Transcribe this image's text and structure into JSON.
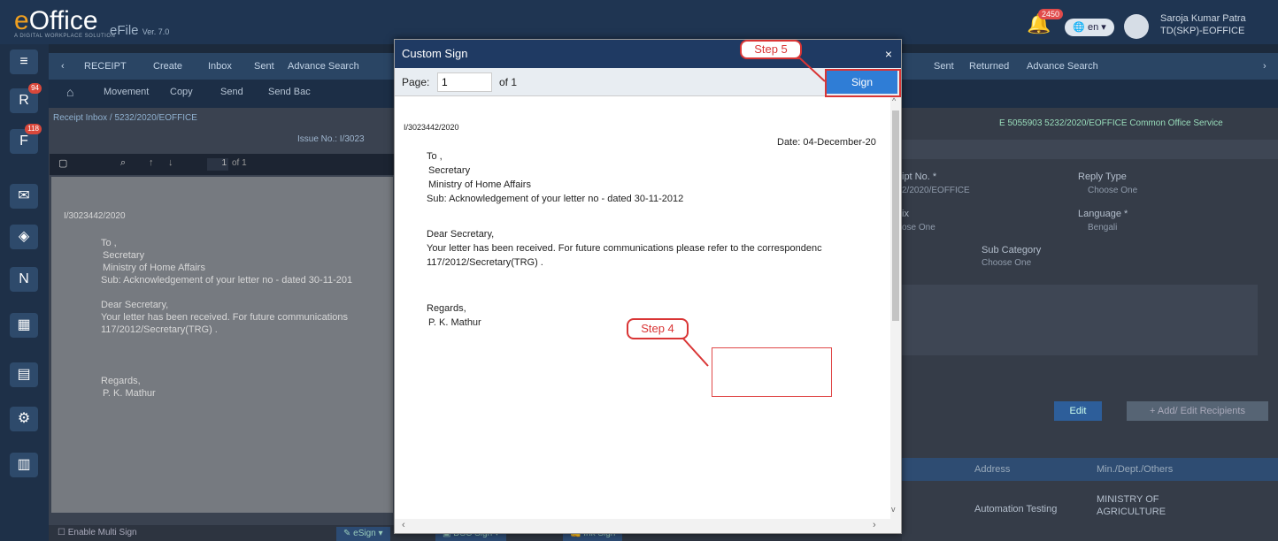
{
  "app": {
    "logo": "eOffice",
    "logo_tagline": "A DIGITAL WORKPLACE SOLUTION",
    "module": "eFile",
    "version": "Ver. 7.0",
    "notification_count": "2450",
    "language": "en",
    "user_name": "Saroja Kumar Patra",
    "user_role": "TD(SKP)-EOFFICE"
  },
  "rail": {
    "badge_receipt": "94",
    "badge_file": "118"
  },
  "nav": {
    "receipt": "RECEIPT",
    "create": "Create",
    "inbox": "Inbox",
    "sent": "Sent",
    "advance": "Advance Search",
    "sent2": "Sent",
    "returned": "Returned",
    "advance2": "Advance Search"
  },
  "subnav": {
    "movement": "Movement",
    "copy": "Copy",
    "send": "Send",
    "send_back": "Send Bac"
  },
  "breadcrumb": "Receipt Inbox  /  5232/2020/EOFFICE",
  "issue": "Issue No.: I/3023",
  "right_header": "E  5055903   5232/2020/EOFFICE   Common Office Service",
  "right": {
    "receipt_no_label": "ipt No. *",
    "receipt_no_value": "2/2020/EOFFICE",
    "reply_type_label": "Reply Type",
    "reply_type_value": "Choose One",
    "prefix_label": "ix",
    "prefix_value": "ose One",
    "language_label": "Language *",
    "language_value": "Bengali",
    "subcat_label": "Sub Category",
    "subcat_value": "Choose One",
    "edit": "Edit",
    "add_recipients": "+ Add/ Edit Recipients",
    "col_address": "Address",
    "col_min": "Min./Dept./Others",
    "row_address": "Automation Testing",
    "row_min": "MINISTRY OF AGRICULTURE"
  },
  "viewer": {
    "page": "1",
    "of": "of 1"
  },
  "preview": {
    "ref": "I/3023442/2020",
    "to": "To ,",
    "l1": "Secretary",
    "l2": "Ministry of Home Affairs",
    "sub": "Sub: Acknowledgement of your letter no - dated 30-11-201",
    "dear": "Dear Secretary,",
    "body1": "Your letter has been received. For future communications",
    "body2": "117/2012/Secretary(TRG) .",
    "regards": "Regards,",
    "name": "P. K. Mathur"
  },
  "footer": {
    "multi": "Enable Multi Sign",
    "esign": "eSign",
    "dsc": "DSC Sign",
    "ink": "Ink Sign"
  },
  "dialog": {
    "title": "Custom Sign",
    "close": "×",
    "page_label": "Page:",
    "page_value": "1",
    "page_of": "of 1",
    "sign_button": "Sign",
    "doc": {
      "ref": "I/3023442/2020",
      "date": "Date: 04-December-20",
      "to": "To ,",
      "l1": "Secretary",
      "l2": "Ministry of Home Affairs",
      "sub": "Sub: Acknowledgement of your letter no - dated 30-11-2012",
      "dear": "Dear Secretary,",
      "body1": "Your letter has been received. For future communications please refer to the correspondenc",
      "body2": "117/2012/Secretary(TRG) .",
      "regards": "Regards,",
      "name": "P. K. Mathur"
    }
  },
  "callouts": {
    "step4": "Step 4",
    "step5": "Step 5"
  },
  "colors": {
    "accent": "#2f7dd6",
    "callout": "#d93535",
    "header": "#1f3a63"
  }
}
